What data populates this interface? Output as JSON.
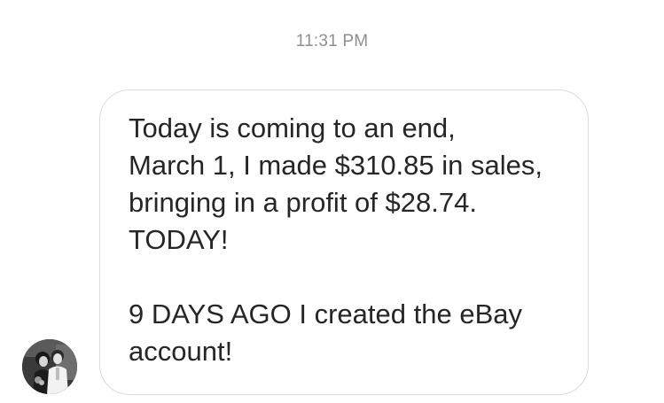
{
  "chat": {
    "timestamp": "11:31 PM",
    "message": {
      "lines": [
        "Today is coming to an end,",
        "March 1, I made $310.85 in sales,",
        "bringing in a profit of $28.74.",
        "TODAY!",
        "",
        "9 DAYS AGO I created the eBay",
        "account!"
      ]
    },
    "avatar": {
      "icon": "user-photo-avatar",
      "style": "black-and-white photo"
    }
  },
  "colors": {
    "background": "#ffffff",
    "timestamp_text": "#8e8e8e",
    "message_text": "#262626",
    "bubble_border": "#dbdbdb"
  }
}
